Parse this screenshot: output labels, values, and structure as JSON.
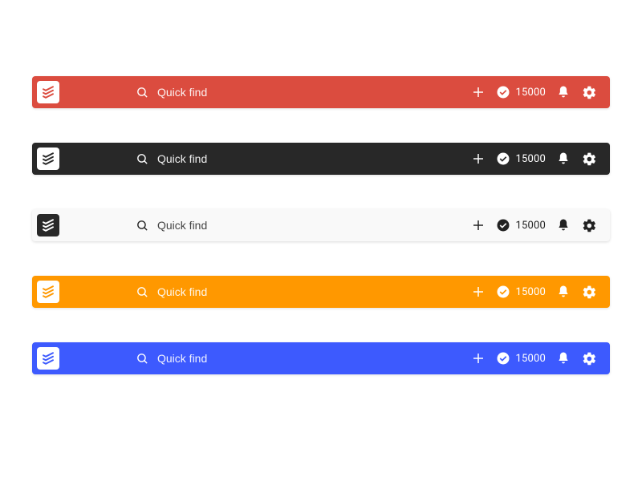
{
  "search": {
    "placeholder": "Quick find"
  },
  "counter": "15000",
  "toolbars": [
    {
      "theme": "red",
      "background": "#db4c3f",
      "foreground": "#ffffff"
    },
    {
      "theme": "dark",
      "background": "#282828",
      "foreground": "#ffffff"
    },
    {
      "theme": "light",
      "background": "#f9f9f9",
      "foreground": "#222222"
    },
    {
      "theme": "orange",
      "background": "#ff9800",
      "foreground": "#ffffff"
    },
    {
      "theme": "blue",
      "background": "#3d5afe",
      "foreground": "#ffffff"
    }
  ],
  "icons": {
    "logo": "todoist-logo",
    "search": "search-icon",
    "add": "plus-icon",
    "productivity": "check-circle-icon",
    "notifications": "bell-icon",
    "settings": "gear-icon"
  }
}
